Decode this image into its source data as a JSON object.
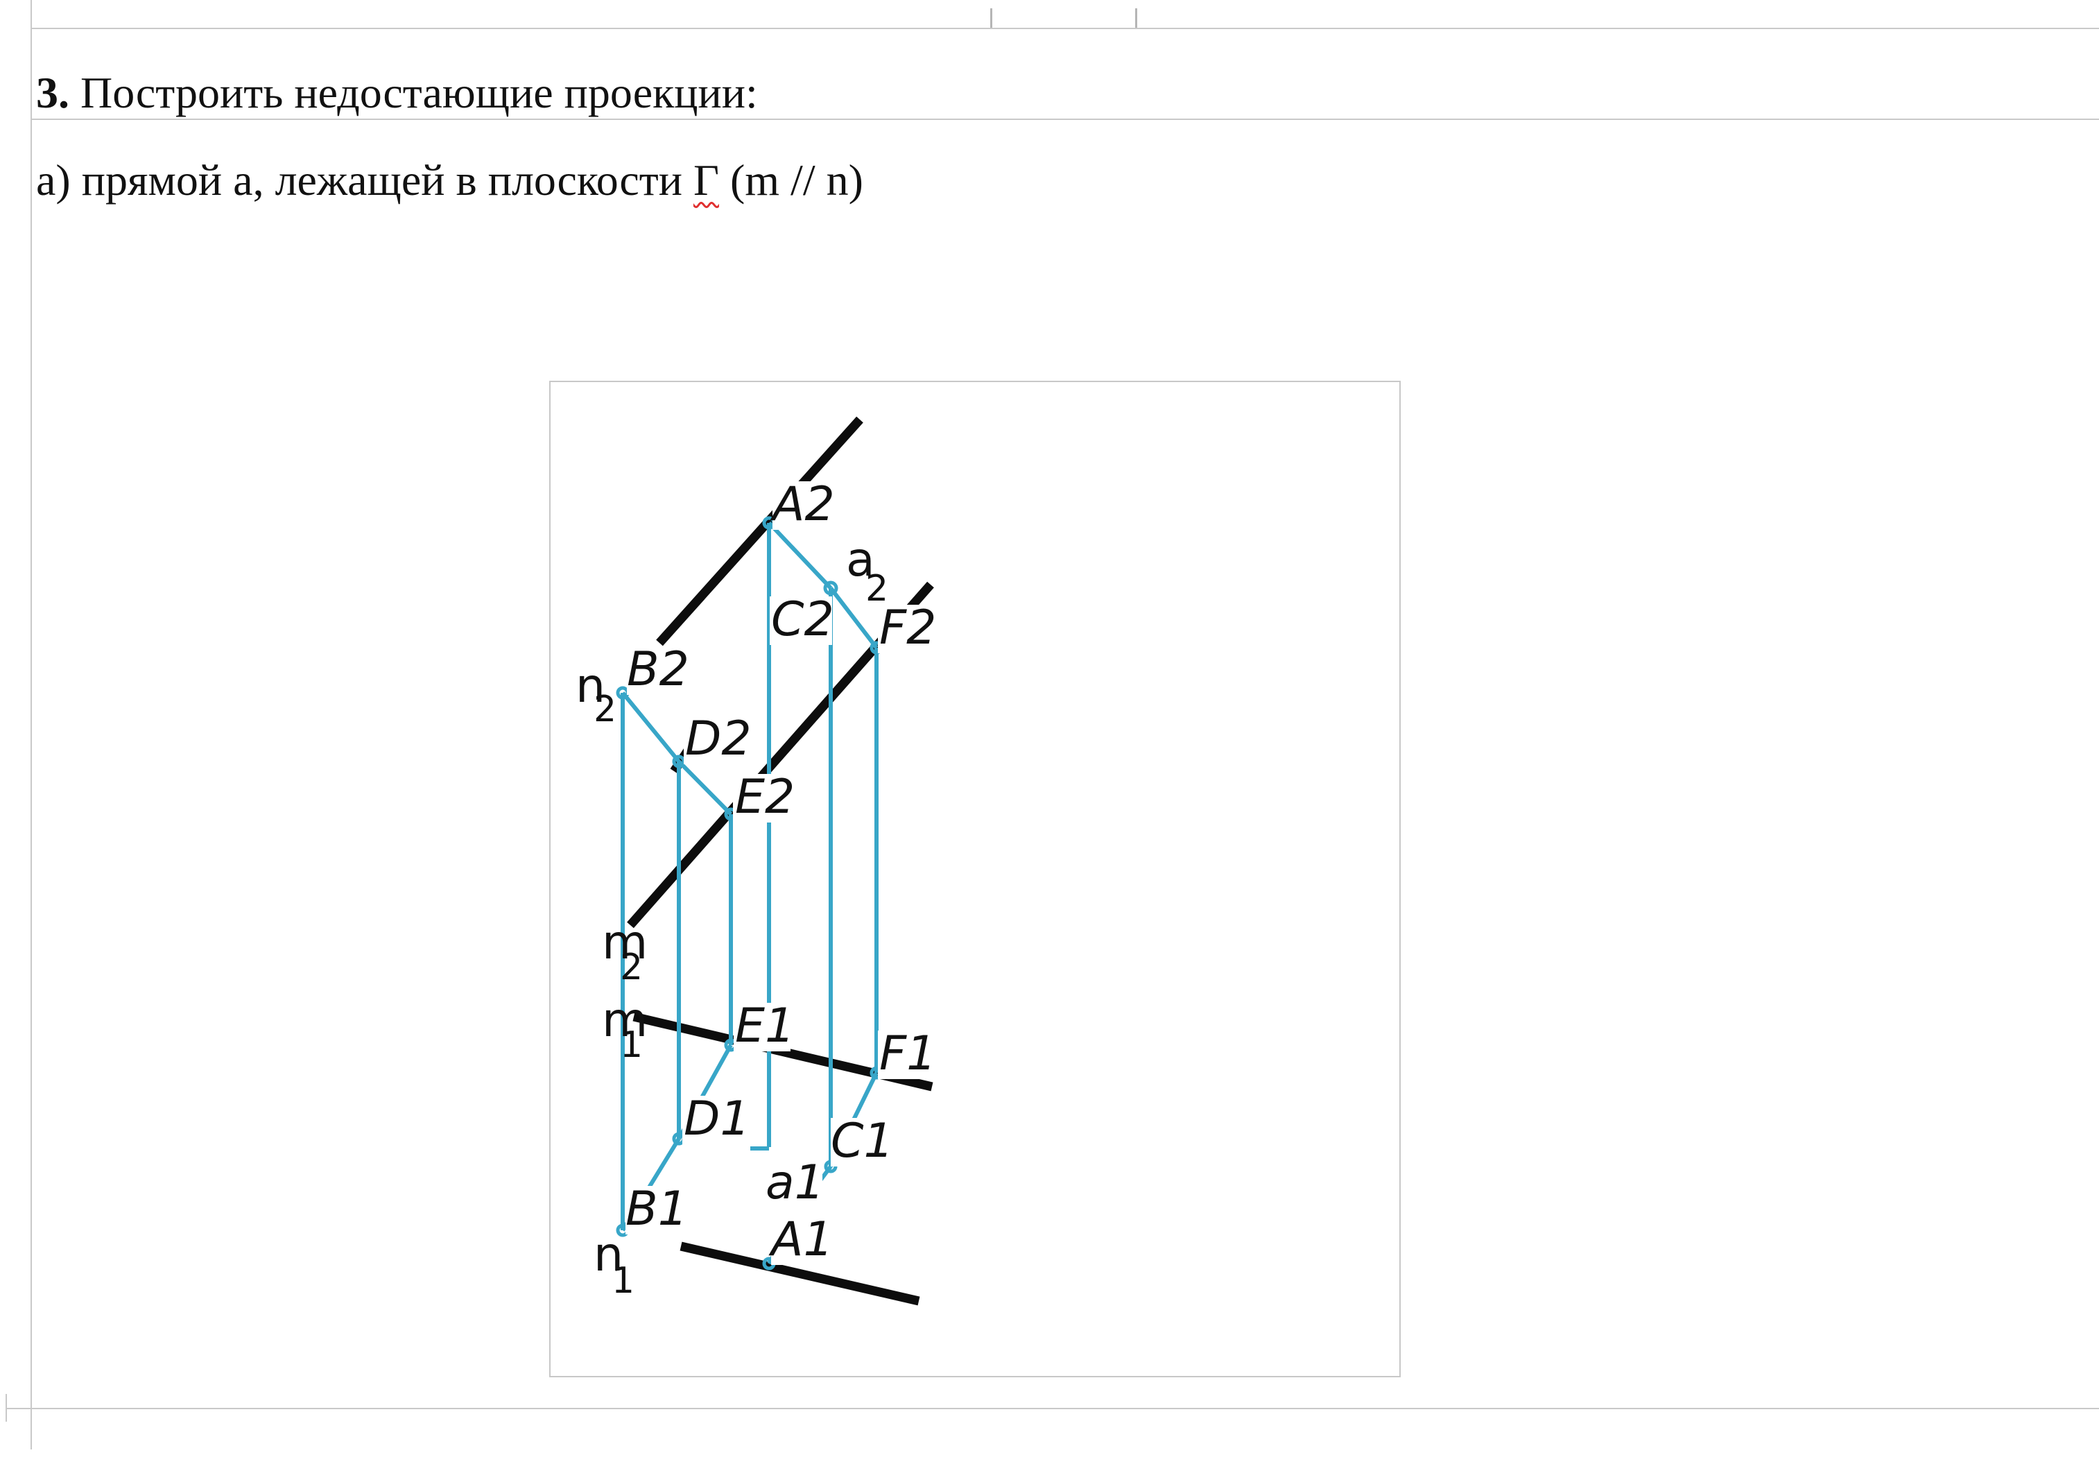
{
  "task": {
    "number": "3.",
    "title": "Построить недостающие проекции:",
    "subtitle_prefix": "а) прямой а, лежащей в плоскости ",
    "subtitle_gamma": "Γ",
    "subtitle_suffix": " (m // n)"
  },
  "figure": {
    "labels": {
      "A2": "A2",
      "C2": "C2",
      "F2": "F2",
      "B2": "B2",
      "D2": "D2",
      "E2": "E2",
      "a2_main": "a",
      "a2_sub": "2",
      "n2_main": "n",
      "n2_sub": "2",
      "m2_main": "m",
      "m2_sub": "2",
      "m1_main": "m",
      "m1_sub": "1",
      "n1_main": "n",
      "n1_sub": "1",
      "E1": "E1",
      "F1": "F1",
      "D1": "D1",
      "C1": "C1",
      "a1": "a1",
      "B1": "B1",
      "A1": "A1"
    },
    "colors": {
      "plane_lines": "#0d0d0d",
      "construction_lines": "#38a6c8",
      "spellcheck_underline": "#e03030"
    }
  }
}
